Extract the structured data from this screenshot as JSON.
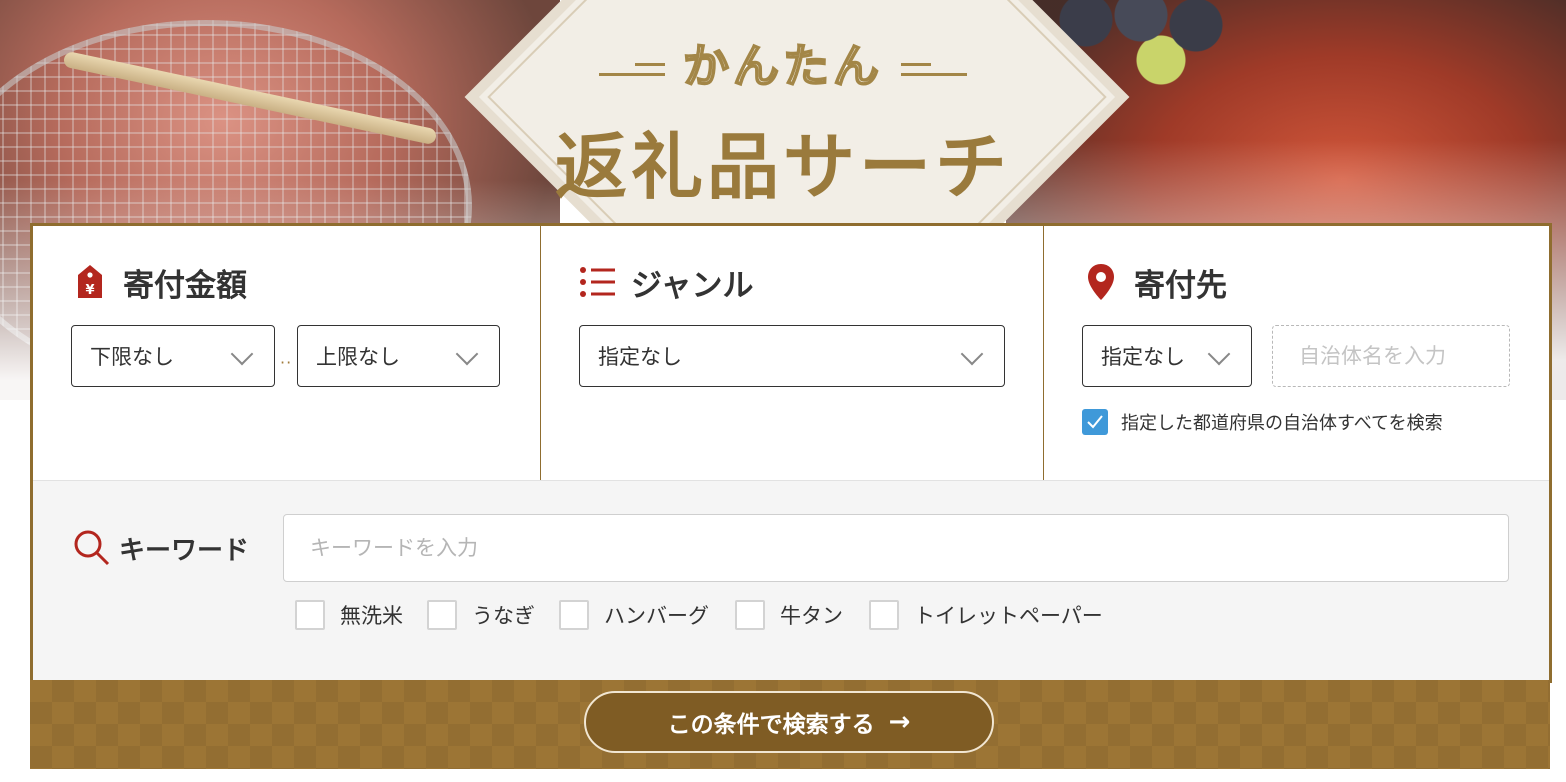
{
  "hero": {
    "title_small": "かんたん",
    "title_big": "返礼品サーチ"
  },
  "amount": {
    "heading": "寄付金額",
    "icon": "yen-tag-icon",
    "min_value": "下限なし",
    "separator": "··",
    "max_value": "上限なし"
  },
  "genre": {
    "heading": "ジャンル",
    "icon": "list-icon",
    "value": "指定なし"
  },
  "destination": {
    "heading": "寄付先",
    "icon": "map-pin-icon",
    "prefecture_value": "指定なし",
    "town_placeholder": "自治体名を入力",
    "search_all_label": "指定した都道府県の自治体すべてを検索",
    "search_all_checked": true
  },
  "keyword": {
    "label": "キーワード",
    "icon": "search-icon",
    "placeholder": "キーワードを入力",
    "tags": [
      "無洗米",
      "うなぎ",
      "ハンバーグ",
      "牛タン",
      "トイレットペーパー"
    ]
  },
  "submit": {
    "label": "この条件で検索する",
    "arrow": "→"
  },
  "colors": {
    "brand_gold": "#8f6d2f",
    "accent_red": "#b3261e",
    "check_blue": "#3f99d9",
    "title_gold": "#9a7a3c"
  }
}
